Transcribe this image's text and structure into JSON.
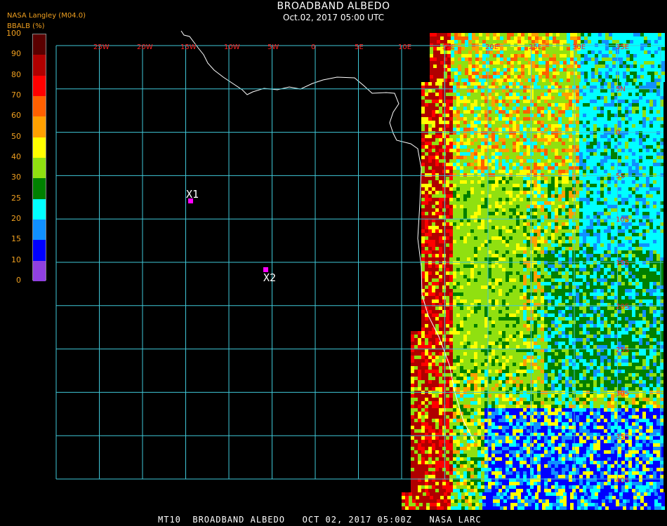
{
  "header": {
    "title": "BROADBAND ALBEDO",
    "subtitle": "Oct.02, 2017 05:00 UTC",
    "source": "NASA Langley (M04.0)",
    "unit_label": "BBALB (%)"
  },
  "footer": {
    "text": "MT10  BROADBAND ALBEDO   OCT 02, 2017 05:00Z   NASA LARC"
  },
  "colorbar": {
    "ticks": [
      "100",
      "90",
      "80",
      "70",
      "60",
      "50",
      "40",
      "30",
      "25",
      "20",
      "15",
      "10",
      "0"
    ],
    "bands": [
      {
        "from": 90,
        "to": 100,
        "color": "#5a0000"
      },
      {
        "from": 80,
        "to": 90,
        "color": "#b00000"
      },
      {
        "from": 70,
        "to": 80,
        "color": "#ff0000"
      },
      {
        "from": 60,
        "to": 70,
        "color": "#ff6000"
      },
      {
        "from": 50,
        "to": 60,
        "color": "#ffa000"
      },
      {
        "from": 40,
        "to": 50,
        "color": "#ffff00"
      },
      {
        "from": 30,
        "to": 40,
        "color": "#90e010"
      },
      {
        "from": 25,
        "to": 30,
        "color": "#008000"
      },
      {
        "from": 20,
        "to": 25,
        "color": "#00ffff"
      },
      {
        "from": 15,
        "to": 20,
        "color": "#1090ff"
      },
      {
        "from": 10,
        "to": 15,
        "color": "#0000ff"
      },
      {
        "from": 0,
        "to": 10,
        "color": "#9040e0"
      }
    ]
  },
  "map": {
    "lon_labels": [
      "25W",
      "20W",
      "15W",
      "10W",
      "5W",
      "0",
      "5E",
      "10E",
      "15E",
      "20E",
      "25E",
      "30E",
      "35E"
    ],
    "lat_labels": [
      "5N",
      "0",
      "5S",
      "10S",
      "15S",
      "20S",
      "25S",
      "30S",
      "35S",
      "40S"
    ],
    "grid_color": "#40c8d8",
    "coast_color": "#ffffff"
  },
  "markers": [
    {
      "label": "X1"
    },
    {
      "label": "X2"
    }
  ]
}
